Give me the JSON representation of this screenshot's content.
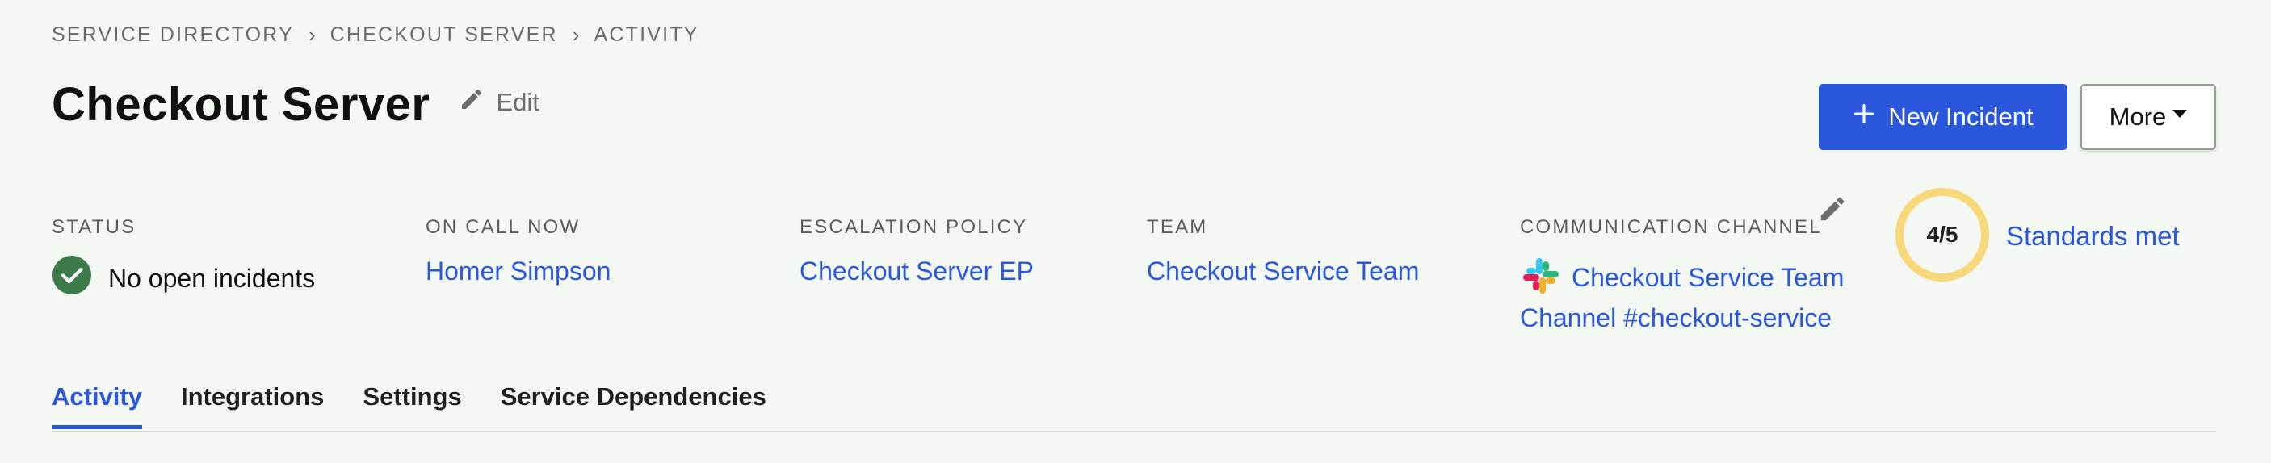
{
  "breadcrumb": [
    "SERVICE DIRECTORY",
    "CHECKOUT SERVER",
    "ACTIVITY"
  ],
  "breadcrumb_separator": "›",
  "page": {
    "title": "Checkout Server",
    "edit_label": "Edit"
  },
  "actions": {
    "new_incident_label": "New Incident",
    "more_label": "More"
  },
  "fields": {
    "status": {
      "label": "STATUS",
      "value": "No open incidents"
    },
    "on_call": {
      "label": "ON CALL NOW",
      "value": "Homer Simpson"
    },
    "escalation": {
      "label": "ESCALATION POLICY",
      "value": "Checkout Server EP"
    },
    "team": {
      "label": "TEAM",
      "value": "Checkout Service Team"
    },
    "communication": {
      "label": "COMMUNICATION CHANNEL",
      "value_line1": "Checkout Service Team",
      "value_line2": "Channel #checkout-service"
    }
  },
  "standards": {
    "score": "4/5",
    "met": 4,
    "total": 5,
    "link": "Standards met",
    "ring_color": "#f6d77a"
  },
  "tabs": [
    "Activity",
    "Integrations",
    "Settings",
    "Service Dependencies"
  ],
  "active_tab": "Activity",
  "colors": {
    "accent": "#2a57dc",
    "success": "#3d7a4a",
    "background": "#f3f8f2"
  },
  "icons": [
    "pencil-icon",
    "plus-icon",
    "caret-down-icon",
    "check-circle-icon",
    "slack-icon"
  ]
}
